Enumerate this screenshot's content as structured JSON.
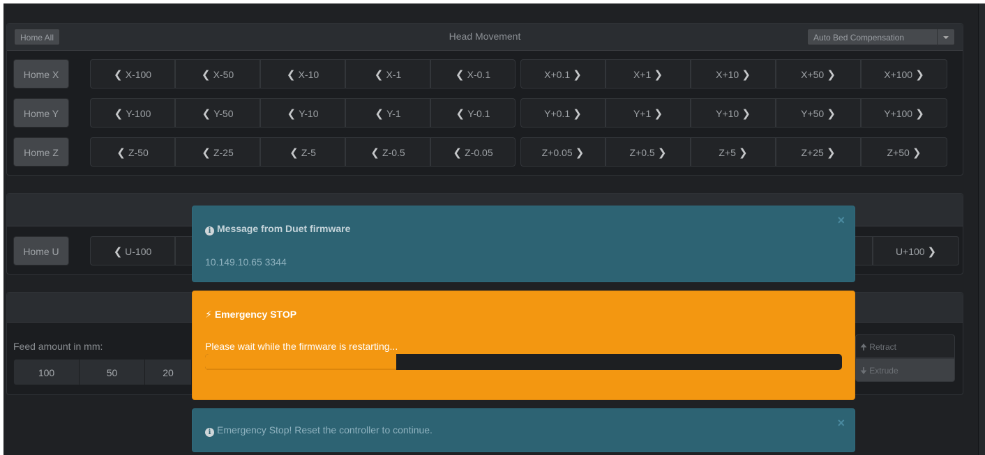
{
  "head_movement": {
    "home_all": "Home All",
    "title": "Head Movement",
    "auto_bed": "Auto Bed Compensation",
    "rows": [
      {
        "home": "Home X",
        "minus": [
          "X-100",
          "X-50",
          "X-10",
          "X-1",
          "X-0.1"
        ],
        "plus": [
          "X+0.1",
          "X+1",
          "X+10",
          "X+50",
          "X+100"
        ]
      },
      {
        "home": "Home Y",
        "minus": [
          "Y-100",
          "Y-50",
          "Y-10",
          "Y-1",
          "Y-0.1"
        ],
        "plus": [
          "Y+0.1",
          "Y+1",
          "Y+10",
          "Y+50",
          "Y+100"
        ]
      },
      {
        "home": "Home Z",
        "minus": [
          "Z-50",
          "Z-25",
          "Z-5",
          "Z-0.5",
          "Z-0.05"
        ],
        "plus": [
          "Z+0.05",
          "Z+0.5",
          "Z+5",
          "Z+25",
          "Z+50"
        ]
      }
    ]
  },
  "u_axis": {
    "home": "Home U",
    "first_minus": "U-100",
    "last_plus": "U+100"
  },
  "extruder": {
    "feed_label": "Feed amount in mm:",
    "feed_amounts": [
      "100",
      "50",
      "20"
    ],
    "retract": "Retract",
    "extrude": "Extrude"
  },
  "alerts": {
    "message": {
      "title": "Message from Duet firmware",
      "body": "10.149.10.65 3344",
      "icon": "info-circle-icon"
    },
    "emergency": {
      "title": "Emergency STOP",
      "body": "Please wait while the firmware is restarting...",
      "progress": 0.3,
      "icon": "bolt-icon"
    },
    "reset": {
      "body": "Emergency Stop! Reset the controller to continue.",
      "icon": "info-circle-icon"
    }
  },
  "colors": {
    "info": "#2d6373",
    "warning": "#f39711",
    "background": "#1f2124"
  }
}
